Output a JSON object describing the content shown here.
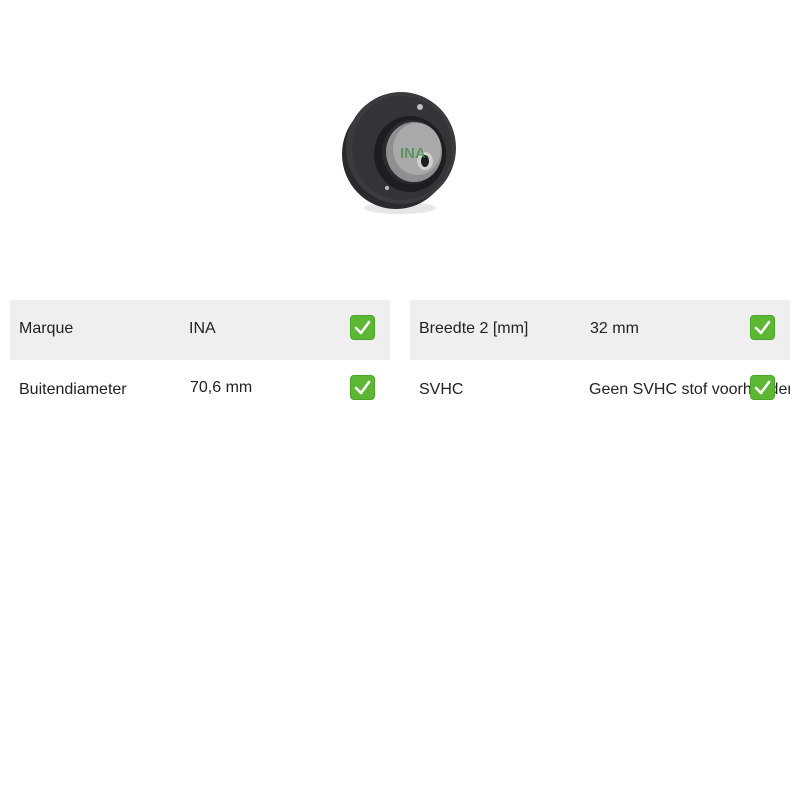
{
  "product": {
    "image_name": "tensioner-pulley-image",
    "logo_text": "INA"
  },
  "specs_left": [
    {
      "label": "Marque",
      "value": "INA",
      "status_icon": "check-icon"
    },
    {
      "label": "Buitendiameter",
      "value": "70,6 mm",
      "status_icon": "check-icon"
    }
  ],
  "specs_right": [
    {
      "label": "Breedte 2 [mm]",
      "value": "32 mm",
      "status_icon": "check-icon"
    },
    {
      "label": "SVHC",
      "value": "Geen SVHC stof voorhanden",
      "status_icon": "check-icon"
    }
  ],
  "colors": {
    "row_shade": "#efefef",
    "check_green": "#5cb833"
  }
}
